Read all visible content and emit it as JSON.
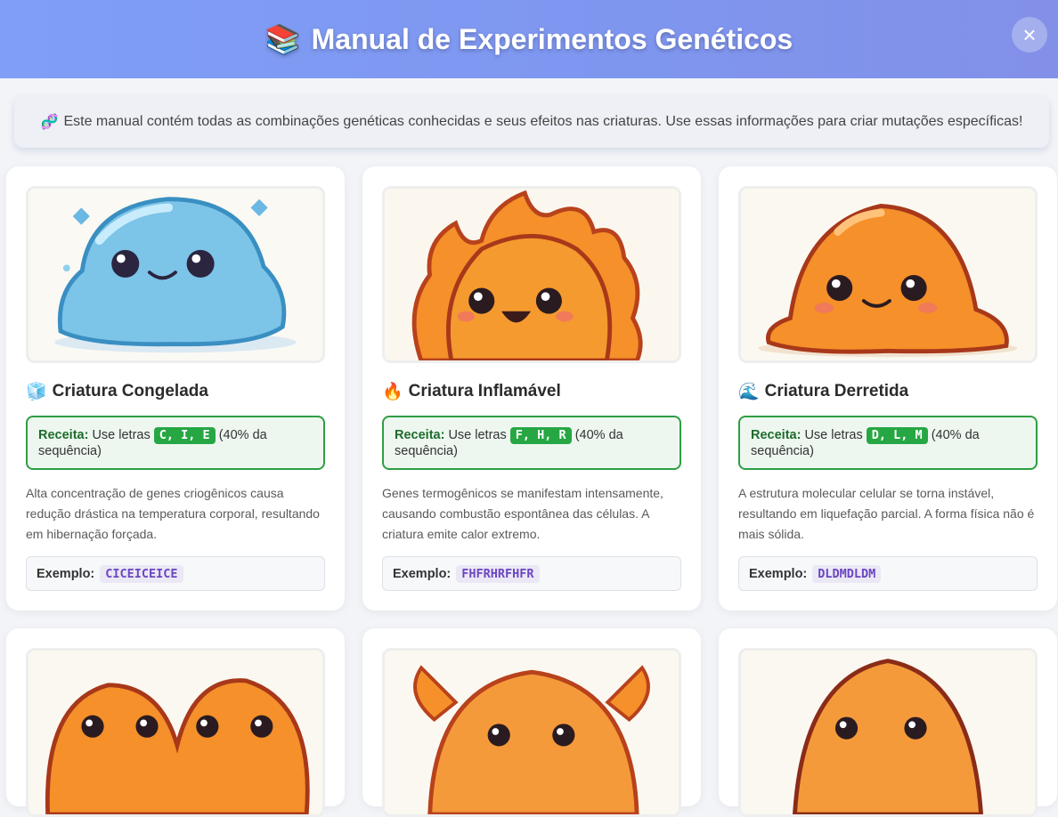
{
  "header": {
    "icon": "📚",
    "title": "Manual de Experimentos Genéticos",
    "close_label": "×"
  },
  "info": {
    "icon": "🧬",
    "text": "Este manual contém todas as combinações genéticas conhecidas e seus efeitos nas criaturas. Use essas informações para criar mutações específicas!"
  },
  "cards": [
    {
      "icon": "🧊",
      "title": "Criatura Congelada",
      "recipe_label": "Receita:",
      "recipe_prefix": "Use letras",
      "letters": "C, I, E",
      "recipe_suffix": "(40% da sequência)",
      "description": "Alta concentração de genes criogênicos causa redução drástica na temperatura corporal, resultando em hibernação forçada.",
      "example_label": "Exemplo:",
      "example": "CICEICEICE"
    },
    {
      "icon": "🔥",
      "title": "Criatura Inflamável",
      "recipe_label": "Receita:",
      "recipe_prefix": "Use letras",
      "letters": "F, H, R",
      "recipe_suffix": "(40% da sequência)",
      "description": "Genes termogênicos se manifestam intensamente, causando combustão espontânea das células. A criatura emite calor extremo.",
      "example_label": "Exemplo:",
      "example": "FHFRHRFHFR"
    },
    {
      "icon": "🌊",
      "title": "Criatura Derretida",
      "recipe_label": "Receita:",
      "recipe_prefix": "Use letras",
      "letters": "D, L, M",
      "recipe_suffix": "(40% da sequência)",
      "description": "A estrutura molecular celular se torna instável, resultando em liquefação parcial. A forma física não é mais sólida.",
      "example_label": "Exemplo:",
      "example": "DLDMDLDM"
    }
  ],
  "colors": {
    "header_gradient_start": "#7f9ef6",
    "header_gradient_end": "#8290e8",
    "recipe_border": "#2e9e44",
    "letters_bg": "#27a744",
    "example_code": "#6b46c1"
  }
}
